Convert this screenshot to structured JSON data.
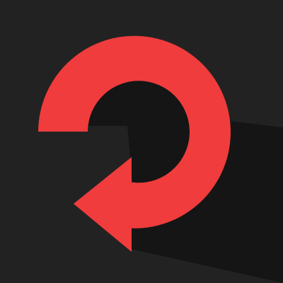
{
  "icon": {
    "name": "rotate-arrow-icon",
    "color": "#f03c3c",
    "background": "#222222",
    "shadow_color": "#151515"
  }
}
